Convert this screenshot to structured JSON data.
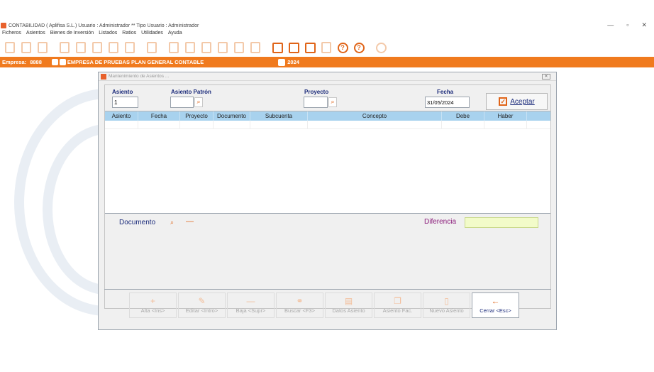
{
  "window": {
    "title": "CONTABILIDAD  ( Aplifisa S.L.)  Usuario : Administrador  **  Tipo Usuario : Administrador",
    "minimize": "—",
    "maximize": "▫",
    "close": "✕"
  },
  "menu": [
    "Ficheros",
    "Asientos",
    "Bienes de Inversión",
    "Listados",
    "Ratios",
    "Utilidades",
    "Ayuda"
  ],
  "company": {
    "label": "Empresa:",
    "code": "8888",
    "name": "EMPRESA DE PRUEBAS PLAN GENERAL CONTABLE",
    "year": "2024"
  },
  "dialog": {
    "title": "Mantenimiento de Asientos ...",
    "close": "✕",
    "asiento_label": "Asiento",
    "asiento_value": "1",
    "patron_label": "Asiento Patrón",
    "proyecto_label": "Proyecto",
    "fecha_label": "Fecha",
    "fecha_value": "31/05/2024",
    "accept_label": "Aceptar",
    "columns": [
      "Asiento",
      "Fecha",
      "Proyecto",
      "Documento",
      "Subcuenta",
      "Concepto",
      "Debe",
      "Haber"
    ],
    "documento_label": "Documento",
    "documento_minus": "—",
    "diferencia_label": "Diferencia",
    "buttons": {
      "alta": "Alta <Ins>",
      "editar": "Editar <Intro>",
      "baja": "Baja <Supr>",
      "buscar": "Buscar <F3>",
      "datos": "Datos Asiento",
      "fac": "Asiento Fac.",
      "nuevo": "Nuevo Asiento",
      "cerrar": "Cerrar <Esc>"
    },
    "button_icons": {
      "alta": "+",
      "editar": "✎",
      "baja": "—",
      "buscar": "⚭",
      "datos": "▤",
      "fac": "❐",
      "nuevo": "▯",
      "cerrar": "←"
    }
  }
}
